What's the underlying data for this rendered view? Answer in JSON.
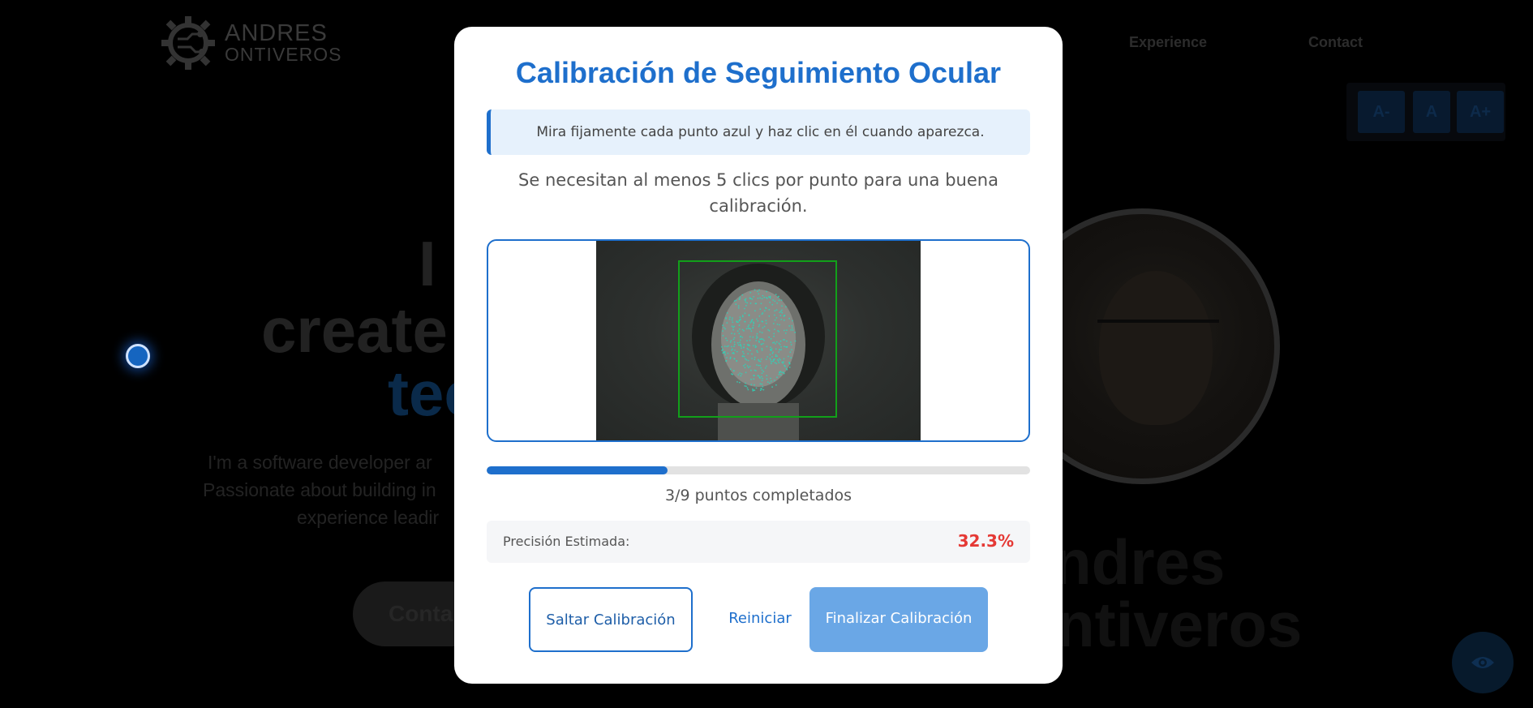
{
  "background": {
    "logo": {
      "name": "ANDRES",
      "subname": "ONTIVEROS"
    },
    "nav": [
      {
        "label": "Experience"
      },
      {
        "label": "Contact"
      }
    ],
    "font_controls": [
      {
        "label": "A-"
      },
      {
        "label": "A"
      },
      {
        "label": "A+"
      }
    ],
    "hero": {
      "line1": "I c",
      "line2": "create",
      "line3": "tec",
      "desc1": "I'm a software developer ar",
      "desc2": "Passionate about building in",
      "desc3": "experience leadir",
      "contact_button": "Conta",
      "name_line1": "ndres",
      "name_line2": "ntiveros"
    }
  },
  "modal": {
    "title": "Calibración de Seguimiento Ocular",
    "info": "Mira fijamente cada punto azul y haz clic en él cuando aparezca.",
    "instruction": "Se necesitan al menos 5 clics por punto para una buena calibración.",
    "progress": {
      "completed": 3,
      "total": 9,
      "text": "3/9 puntos completados"
    },
    "precision": {
      "label": "Precisión Estimada:",
      "value": "32.3%"
    },
    "buttons": {
      "skip": "Saltar Calibración",
      "reset": "Reiniciar",
      "finish": "Finalizar Calibración"
    }
  },
  "colors": {
    "accent": "#1e6fcc",
    "precision_low": "#e53935",
    "face_box": "#12a01a",
    "mesh": "#2ed3b8"
  }
}
